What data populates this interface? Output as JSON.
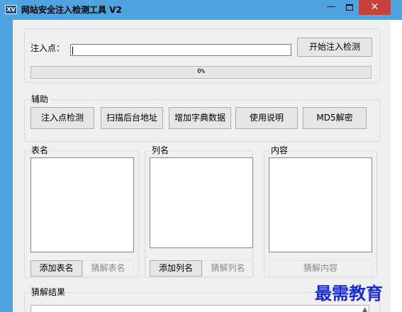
{
  "window": {
    "icon_text": "XV",
    "title": "网站安全注入检测工具 V2",
    "min_glyph": "—",
    "close_glyph": "✕"
  },
  "injection": {
    "label": "注入点：",
    "value": "",
    "start_button": "开始注入检测",
    "progress_percent": 0,
    "progress_text": "0%"
  },
  "aux": {
    "title": "辅助",
    "buttons": [
      "注入点检测",
      "扫描后台地址",
      "增加字典数据",
      "使用说明",
      "MD5解密"
    ]
  },
  "tables": {
    "title": "表名",
    "items": [],
    "add_button": "添加表名",
    "guess_button": "猜解表名"
  },
  "columns": {
    "title": "列名",
    "items": [],
    "add_button": "添加列名",
    "guess_button": "猜解列名"
  },
  "content": {
    "title": "内容",
    "items": [],
    "guess_button": "猜解内容"
  },
  "result": {
    "title": "猜解结果",
    "value": ""
  },
  "watermark": "最需教育",
  "colors": {
    "titlebar": "#4fa4e0",
    "close": "#c7403a",
    "client": "#f0f0f0",
    "progress_fill": "#06b025",
    "watermark": "#1a2bd6"
  }
}
